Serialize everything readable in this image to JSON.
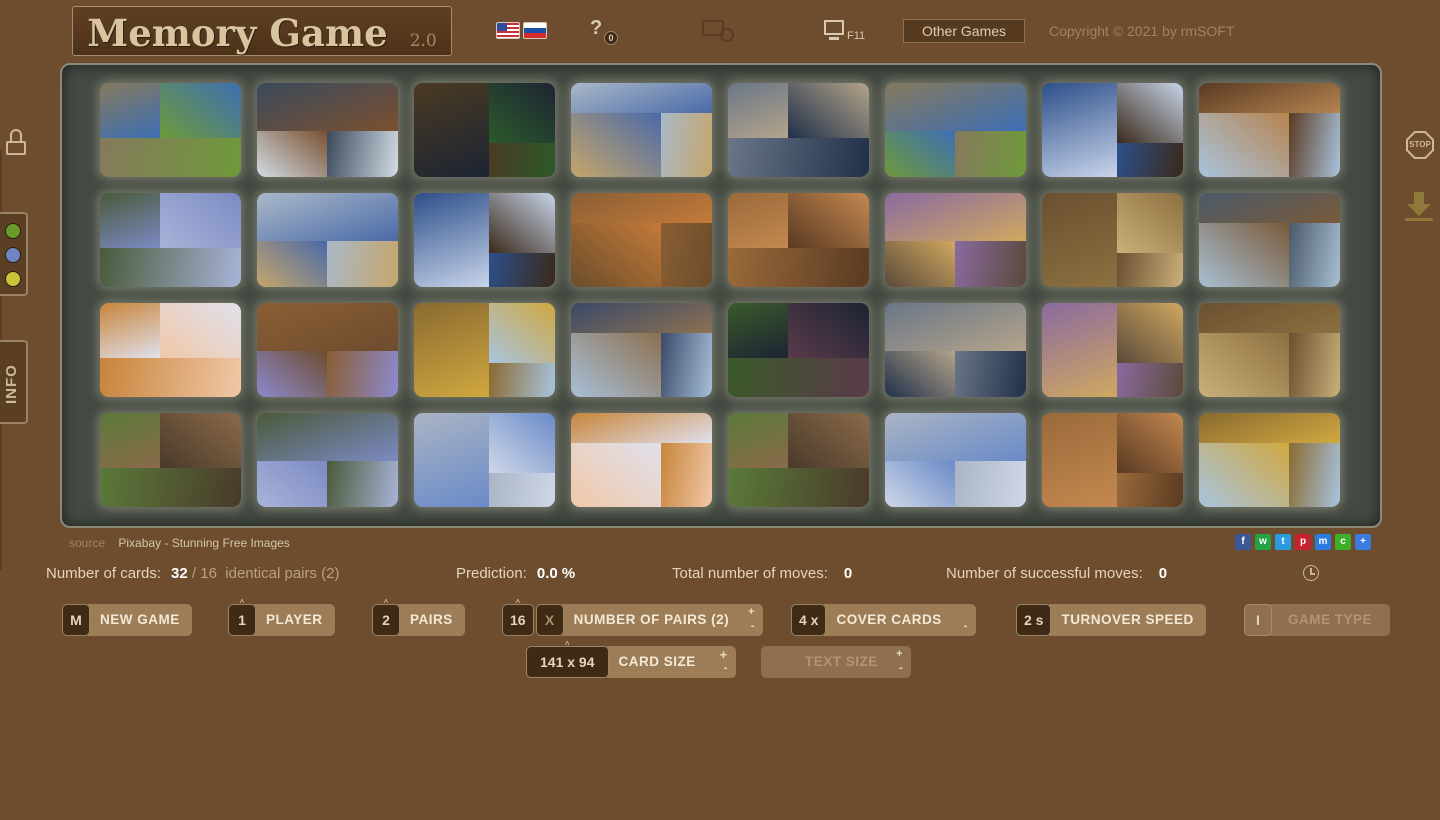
{
  "header": {
    "title": "Memory Game",
    "version": "2.0",
    "help_badge": "0",
    "fullscreen_key": "F11",
    "other_games": "Other Games",
    "copyright": "Copyright © 2021 by rmSOFT"
  },
  "side": {
    "info_label": "INFO",
    "stop_label": "STOP",
    "colors": [
      "#6a9a2a",
      "#6f86c3",
      "#c9c43a"
    ]
  },
  "board": {
    "rows": 4,
    "cols": 8,
    "cards": [
      [
        "#86795d",
        "#3c6fb4",
        "#6e9a3a"
      ],
      [
        "#3b4a5c",
        "#7a5030",
        "#d2dde6"
      ],
      [
        "#4a3a22",
        "#1c2433",
        "#2c5a2a"
      ],
      [
        "#aab8c8",
        "#4a6aa8",
        "#c6a66a"
      ],
      [
        "#6a7688",
        "#b4a48a",
        "#20304a"
      ],
      [
        "#86795d",
        "#3c6fb4",
        "#6e9a3a"
      ],
      [
        "#2d4f8a",
        "#c8d4ea",
        "#3a2a1a"
      ],
      [
        "#5a3a22",
        "#b58450",
        "#a9c4de"
      ],
      [
        "#4a5a3a",
        "#7c8ac4",
        "#a8b4d8"
      ],
      [
        "#aab8c8",
        "#4a6aa8",
        "#c6a66a"
      ],
      [
        "#2d4f8a",
        "#c8d4ea",
        "#3a2a1a"
      ],
      [
        "#8a5e34",
        "#c47a3a",
        "#6b4d2a"
      ],
      [
        "#9a6a3a",
        "#c48850",
        "#5a3a22"
      ],
      [
        "#8a6aa0",
        "#d0a860",
        "#5a4a3a"
      ],
      [
        "#6a5030",
        "#8c7040",
        "#c9b07a"
      ],
      [
        "#4a5a6a",
        "#7a5a3a",
        "#a8c0d4"
      ],
      [
        "#c8843a",
        "#e0e0ec",
        "#f0c8a8"
      ],
      [
        "#8a5e34",
        "#6e4c2e",
        "#8c8ad0"
      ],
      [
        "#8a6a30",
        "#d0a840",
        "#a8c4e0"
      ],
      [
        "#3a4a6a",
        "#8c7050",
        "#a8c0d8"
      ],
      [
        "#3a5a2a",
        "#1c2433",
        "#5a3a4a"
      ],
      [
        "#6a7688",
        "#b4a48a",
        "#20304a"
      ],
      [
        "#8a6aa0",
        "#d0a860",
        "#5a4a3a"
      ],
      [
        "#6a5030",
        "#8c7040",
        "#c9b07a"
      ],
      [
        "#5a7a3a",
        "#8a6a4a",
        "#4a3a2a"
      ],
      [
        "#4a5a3a",
        "#7c8ac4",
        "#a8b4d8"
      ],
      [
        "#aab4c4",
        "#6a8ac8",
        "#d0d8e8"
      ],
      [
        "#c8843a",
        "#e0e0ec",
        "#f0c8a8"
      ],
      [
        "#5a7a3a",
        "#8a6a4a",
        "#4a3a2a"
      ],
      [
        "#aab4c4",
        "#6a8ac8",
        "#d0d8e8"
      ],
      [
        "#9a6a3a",
        "#c48850",
        "#5a3a22"
      ],
      [
        "#8a6a30",
        "#d0a840",
        "#a8c4e0"
      ]
    ]
  },
  "source": {
    "label": "source",
    "link": "Pixabay - Stunning Free Images"
  },
  "share": [
    {
      "icon": "facebook-icon",
      "glyph": "f",
      "color": "#3b5998"
    },
    {
      "icon": "whatsapp-icon",
      "glyph": "w",
      "color": "#25a244"
    },
    {
      "icon": "twitter-icon",
      "glyph": "t",
      "color": "#2a9be0"
    },
    {
      "icon": "pinterest-icon",
      "glyph": "p",
      "color": "#c8232c"
    },
    {
      "icon": "messenger-icon",
      "glyph": "m",
      "color": "#2a7be4"
    },
    {
      "icon": "wechat-icon",
      "glyph": "c",
      "color": "#3fae29"
    },
    {
      "icon": "more-share-icon",
      "glyph": "+",
      "color": "#3a7be0"
    }
  ],
  "stats": {
    "cards_label": "Number of cards:",
    "cards_value": "32",
    "cards_separator": "/",
    "pairs_value": "16",
    "pairs_label": "identical pairs (2)",
    "prediction_label": "Prediction:",
    "prediction_value": "0.0 %",
    "moves_label": "Total number of moves:",
    "moves_value": "0",
    "success_label": "Number of successful moves:",
    "success_value": "0"
  },
  "controls": {
    "new_game": {
      "key": "M",
      "label": "NEW GAME"
    },
    "player": {
      "key": "1",
      "label": "PLAYER"
    },
    "pairs": {
      "key": "2",
      "label": "PAIRS"
    },
    "num_pairs": {
      "key": "16",
      "key2": "X",
      "label": "NUMBER OF PAIRS (2)"
    },
    "cover": {
      "key": "4 x",
      "label": "COVER CARDS"
    },
    "turnover": {
      "key": "2 s",
      "label": "TURNOVER SPEED"
    },
    "game_type": {
      "key": "I",
      "label": "GAME TYPE"
    },
    "card_size": {
      "key": "141 x 94",
      "label": "CARD SIZE"
    },
    "text_size": {
      "key": "",
      "label": "TEXT SIZE"
    },
    "plus": "+",
    "minus": "-"
  }
}
